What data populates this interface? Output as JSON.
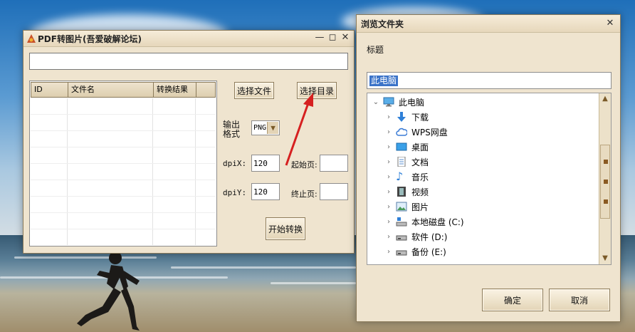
{
  "main_window": {
    "title": "PDF转图片(吾爱破解论坛)",
    "path_value": "",
    "table": {
      "columns": [
        "ID",
        "文件名",
        "转换结果"
      ],
      "rows": []
    },
    "select_file_label": "选择文件",
    "select_dir_label": "选择目录",
    "output_format_label": "输出格式",
    "output_format_value": "PNG",
    "dpix_label": "dpiX:",
    "dpix_value": "120",
    "dpiy_label": "dpiY:",
    "dpiy_value": "120",
    "start_page_label": "起始页:",
    "start_page_value": "",
    "end_page_label": "终止页:",
    "end_page_value": "",
    "start_convert_label": "开始转换"
  },
  "folder_dialog": {
    "title": "浏览文件夹",
    "caption": "标题",
    "selected_path": "此电脑",
    "tree": [
      {
        "label": "此电脑",
        "icon": "computer-icon",
        "level": 0,
        "expanded": true
      },
      {
        "label": "下载",
        "icon": "download-arrow-icon",
        "level": 1
      },
      {
        "label": "WPS网盘",
        "icon": "cloud-icon",
        "level": 1
      },
      {
        "label": "桌面",
        "icon": "desktop-icon",
        "level": 1
      },
      {
        "label": "文档",
        "icon": "document-icon",
        "level": 1
      },
      {
        "label": "音乐",
        "icon": "music-note-icon",
        "level": 1
      },
      {
        "label": "视频",
        "icon": "film-icon",
        "level": 1
      },
      {
        "label": "图片",
        "icon": "picture-icon",
        "level": 1
      },
      {
        "label": "本地磁盘 (C:)",
        "icon": "system-drive-icon",
        "level": 1
      },
      {
        "label": "软件 (D:)",
        "icon": "drive-icon",
        "level": 1
      },
      {
        "label": "备份 (E:)",
        "icon": "drive-icon",
        "level": 1
      }
    ],
    "ok_label": "确定",
    "cancel_label": "取消"
  },
  "colors": {
    "window_bg": "#efe4cf",
    "button_border": "#8d7b59",
    "selection_bg": "#3b73c8",
    "arrow": "#d62020"
  }
}
